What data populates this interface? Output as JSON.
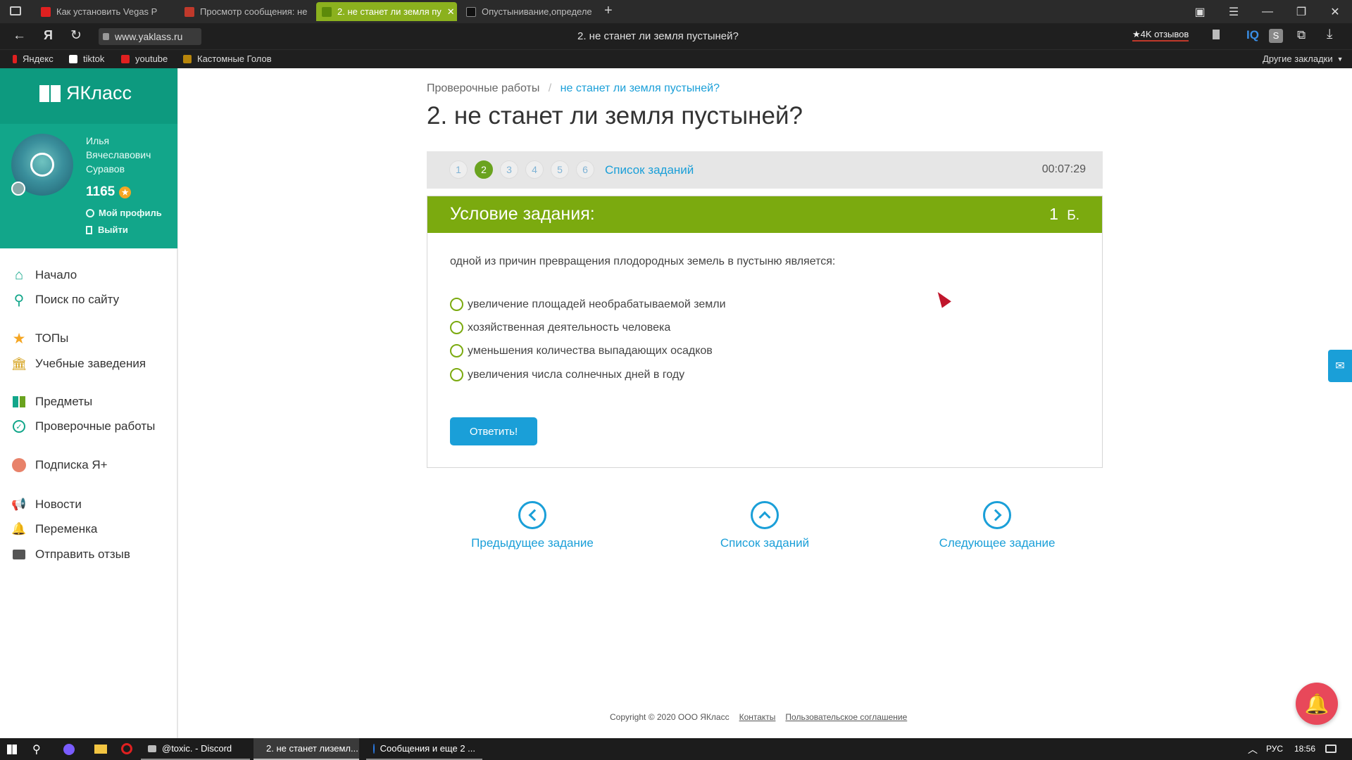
{
  "browser": {
    "tabs": [
      {
        "label": "Как установить Vegas P",
        "fav_color": "#e02020"
      },
      {
        "label": "Просмотр сообщения: не",
        "fav_color": "#c0392b"
      },
      {
        "label": "2. не станет ли земля пу",
        "fav_color": "#7baa0f",
        "active": true
      },
      {
        "label": "Опустынивание,определе",
        "fav_color": "#111111"
      }
    ],
    "url": "www.yaklass.ru",
    "page_title": "2. не станет ли земля пустыней?",
    "reviews_badge": "★4K отзывов",
    "bookmarks": [
      "Яндекс",
      "tiktok",
      "youtube",
      "Кастомные Голов"
    ],
    "other_bookmarks": "Другие закладки"
  },
  "sidebar": {
    "logo": "ЯКласс",
    "user": {
      "first": "Илья",
      "middle": "Вячеславович",
      "last": "Суравов",
      "points": "1165"
    },
    "profile_link": "Мой профиль",
    "logout_link": "Выйти",
    "items": [
      {
        "label": "Начало",
        "icon": "home-icon"
      },
      {
        "label": "Поиск по сайту",
        "icon": "search-icon"
      },
      {
        "label": "ТОПы",
        "icon": "star-icon"
      },
      {
        "label": "Учебные заведения",
        "icon": "school-icon"
      },
      {
        "label": "Предметы",
        "icon": "books-icon"
      },
      {
        "label": "Проверочные работы",
        "icon": "check-icon"
      },
      {
        "label": "Подписка Я+",
        "icon": "plus-icon"
      },
      {
        "label": "Новости",
        "icon": "megaphone-icon"
      },
      {
        "label": "Переменка",
        "icon": "bell-icon"
      },
      {
        "label": "Отправить отзыв",
        "icon": "feedback-icon"
      }
    ]
  },
  "main": {
    "breadcrumb": {
      "root": "Проверочные работы",
      "separator": "/",
      "current": "не станет ли земля пустыней?"
    },
    "title": "2. не станет ли земля пустыней?",
    "tasks": [
      "1",
      "2",
      "3",
      "4",
      "5",
      "6"
    ],
    "active_task": "2",
    "task_list_link": "Список заданий",
    "timer": "00:07:29",
    "card": {
      "heading": "Условие задания:",
      "points": "1",
      "points_unit": "Б.",
      "question": "одной из причин превращения плодородных земель в пустыню является:",
      "options": [
        "увеличение площадей необрабатываемой земли",
        "хозяйственная деятельность человека",
        "уменьшения количества выпадающих осадков",
        "увеличения числа солнечных дней в году"
      ],
      "answer_button": "Ответить!"
    },
    "nav": {
      "prev": "Предыдущее задание",
      "list": "Список заданий",
      "next": "Следующее задание"
    },
    "footer": {
      "copyright": "Copyright © 2020 ООО ЯКласс",
      "contacts": "Контакты",
      "agreement": "Пользовательское соглашение"
    }
  },
  "taskbar": {
    "items": [
      "@toxic. - Discord",
      "2. не станет лиземл...",
      "Сообщения и еще 2 ..."
    ],
    "lang": "РУС",
    "time": "18:56"
  },
  "colors": {
    "brand_green": "#7baa0f",
    "teal": "#12a68a",
    "link_blue": "#1a9fd8"
  }
}
